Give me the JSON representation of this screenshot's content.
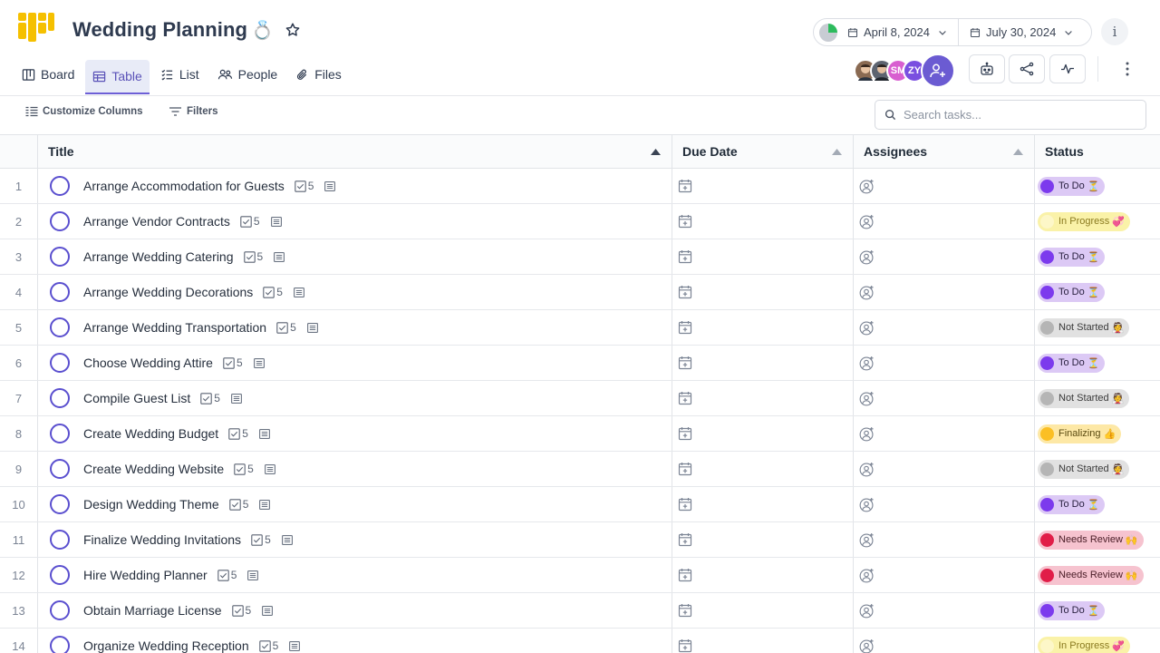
{
  "header": {
    "title": "Wedding Planning",
    "title_emoji": "💍",
    "progress": 0.25,
    "start_date": "April 8, 2024",
    "end_date": "July 30, 2024",
    "info_label": "i"
  },
  "tabs": [
    {
      "label": "Board",
      "icon": "board-icon",
      "active": false
    },
    {
      "label": "Table",
      "icon": "table-icon",
      "active": true
    },
    {
      "label": "List",
      "icon": "list-icon",
      "active": false
    },
    {
      "label": "People",
      "icon": "people-icon",
      "active": false
    },
    {
      "label": "Files",
      "icon": "paperclip-icon",
      "active": false
    }
  ],
  "avatars": [
    {
      "initials": "",
      "color": "#8a6a52"
    },
    {
      "initials": "",
      "color": "#5d6470"
    },
    {
      "initials": "SM",
      "color": "#d85fd0"
    },
    {
      "initials": "ZY",
      "color": "#7a4fe0"
    }
  ],
  "toolbar": {
    "customize_label": "Customize Columns",
    "filters_label": "Filters",
    "search_placeholder": "Search tasks..."
  },
  "columns": {
    "title": "Title",
    "due": "Due Date",
    "assignees": "Assignees",
    "status": "Status"
  },
  "statuses": {
    "todo": {
      "label": "To Do",
      "emoji": "⏳",
      "bg": "#dcc9f5",
      "dot": "#7c3aed",
      "fg": "#2a2140"
    },
    "progress": {
      "label": "In Progress",
      "emoji": "💞",
      "bg": "#faf2a8",
      "dot": "#fdf7c8",
      "fg": "#8a7a20"
    },
    "notstarted": {
      "label": "Not Started",
      "emoji": "👰",
      "bg": "#e1e1e1",
      "dot": "#b5b5b5",
      "fg": "#3a3a3a"
    },
    "finalizing": {
      "label": "Finalizing",
      "emoji": "👍",
      "bg": "#fde8a6",
      "dot": "#fbbf24",
      "fg": "#5a4a10"
    },
    "review": {
      "label": "Needs Review",
      "emoji": "🙌",
      "bg": "#f6c3cf",
      "dot": "#e11d48",
      "fg": "#4a1d27"
    }
  },
  "rows": [
    {
      "num": "1",
      "title": "Arrange Accommodation for Guests",
      "subtasks": "5",
      "status": "todo"
    },
    {
      "num": "2",
      "title": "Arrange Vendor Contracts",
      "subtasks": "5",
      "status": "progress"
    },
    {
      "num": "3",
      "title": "Arrange Wedding Catering",
      "subtasks": "5",
      "status": "todo"
    },
    {
      "num": "4",
      "title": "Arrange Wedding Decorations",
      "subtasks": "5",
      "status": "todo"
    },
    {
      "num": "5",
      "title": "Arrange Wedding Transportation",
      "subtasks": "5",
      "status": "notstarted"
    },
    {
      "num": "6",
      "title": "Choose Wedding Attire",
      "subtasks": "5",
      "status": "todo"
    },
    {
      "num": "7",
      "title": "Compile Guest List",
      "subtasks": "5",
      "status": "notstarted"
    },
    {
      "num": "8",
      "title": "Create Wedding Budget",
      "subtasks": "5",
      "status": "finalizing"
    },
    {
      "num": "9",
      "title": "Create Wedding Website",
      "subtasks": "5",
      "status": "notstarted"
    },
    {
      "num": "10",
      "title": "Design Wedding Theme",
      "subtasks": "5",
      "status": "todo"
    },
    {
      "num": "11",
      "title": "Finalize Wedding Invitations",
      "subtasks": "5",
      "status": "review"
    },
    {
      "num": "12",
      "title": "Hire Wedding Planner",
      "subtasks": "5",
      "status": "review"
    },
    {
      "num": "13",
      "title": "Obtain Marriage License",
      "subtasks": "5",
      "status": "todo"
    },
    {
      "num": "14",
      "title": "Organize Wedding Reception",
      "subtasks": "5",
      "status": "progress"
    }
  ]
}
